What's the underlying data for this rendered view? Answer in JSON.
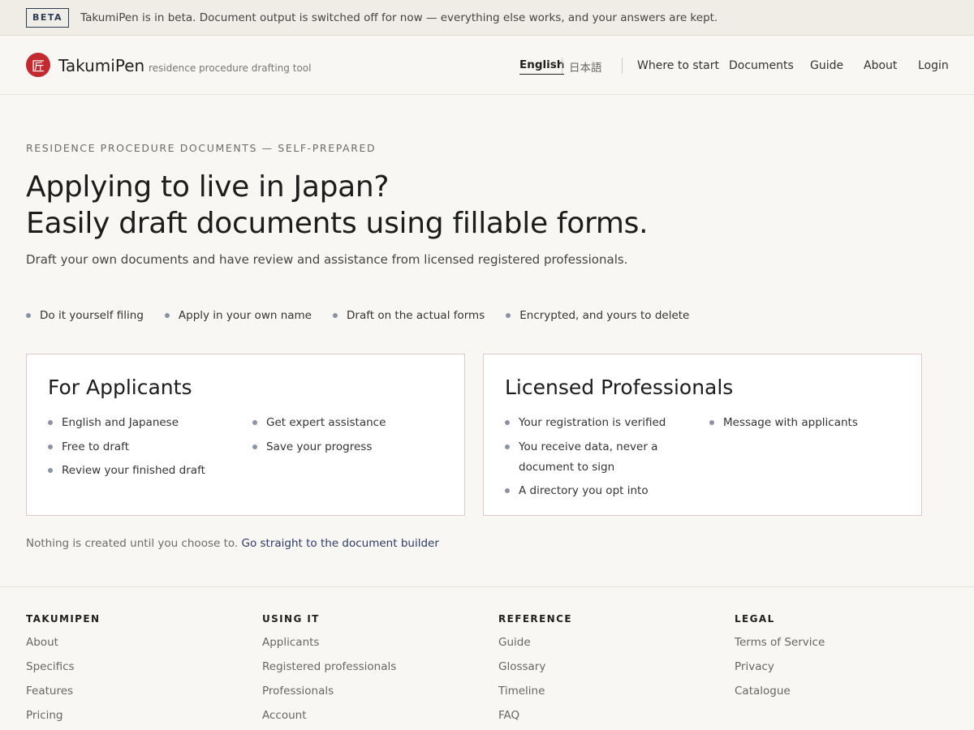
{
  "beta": {
    "badge": "BETA",
    "message": "TakumiPen is in beta. Document output is switched off for now — everything else works, and your answers are kept."
  },
  "header": {
    "logo_glyph": "匠",
    "brand": "TakumiPen",
    "tagline": "residence procedure drafting tool",
    "lang_en": "English",
    "lang_ja": "日本語",
    "nav": [
      "Where to start",
      "Documents",
      "Guide",
      "About",
      "Login"
    ]
  },
  "hero": {
    "eyebrow": "RESIDENCE PROCEDURE DOCUMENTS — SELF-PREPARED",
    "title_line1": "Applying to live in Japan?",
    "title_line2": "Easily draft documents using fillable forms.",
    "subtitle": "Draft your own documents and have review and assistance from licensed registered professionals.",
    "features": [
      "Do it yourself filing",
      "Apply in your own name",
      "Draft on the actual forms",
      "Encrypted, and yours to delete"
    ]
  },
  "cards": [
    {
      "title": "For Applicants",
      "col1": [
        "English and Japanese",
        "Free to draft",
        "Review your finished draft"
      ],
      "col2": [
        "Get expert assistance",
        "Save your progress"
      ]
    },
    {
      "title": "Licensed Professionals",
      "col1": [
        "Your registration is verified",
        "You receive data, never a",
        "document to sign",
        "A directory you opt into"
      ],
      "col2": [
        "Message with applicants"
      ]
    }
  ],
  "note": {
    "text": "Nothing is created until you choose to.",
    "link": "Go straight to the document builder"
  },
  "footer": [
    {
      "heading": "TAKUMIPEN",
      "links": [
        "About",
        "Specifics",
        "Features",
        "Pricing"
      ]
    },
    {
      "heading": "USING IT",
      "links": [
        "Applicants",
        "Registered professionals",
        "Professionals",
        "Account"
      ]
    },
    {
      "heading": "REFERENCE",
      "links": [
        "Guide",
        "Glossary",
        "Timeline",
        "FAQ"
      ]
    },
    {
      "heading": "LEGAL",
      "links": [
        "Terms of Service",
        "Privacy",
        "Catalogue"
      ]
    }
  ],
  "colors": {
    "brand_red": "#c22a2f",
    "link_blue": "#2b3a66",
    "background": "#f8f7f3"
  }
}
